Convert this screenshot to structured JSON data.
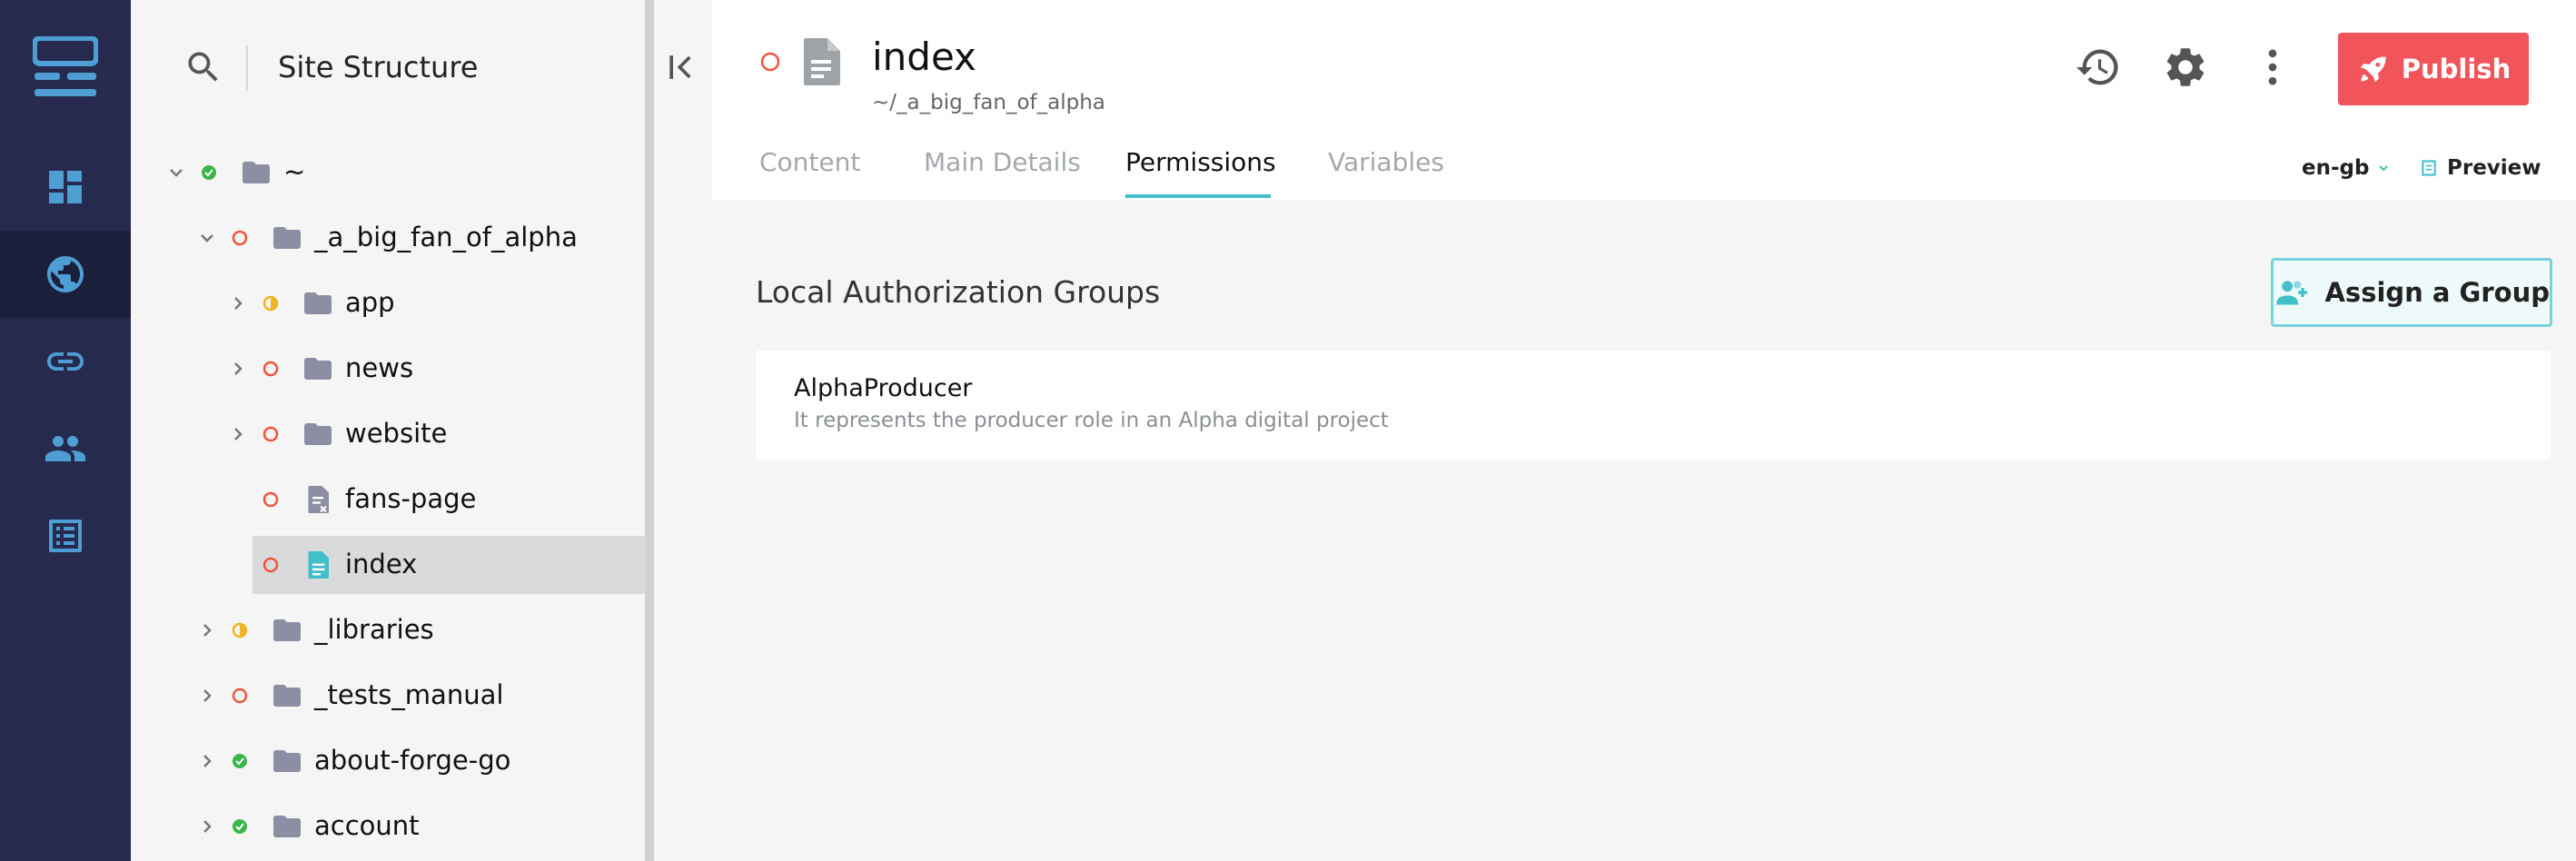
{
  "colors": {
    "rail_bg": "#252a4e",
    "rail_icon": "#4e9ed3",
    "accent_teal": "#42bfcb",
    "publish_red": "#f2545b",
    "status_green": "#3bb54a",
    "status_red": "#f0553c",
    "status_yellow": "#f2b322",
    "folder_gray": "#8c8fa3"
  },
  "rail": {
    "items": [
      {
        "name": "dashboard",
        "icon": "dashboard-icon",
        "active": false
      },
      {
        "name": "sites",
        "icon": "globe-icon",
        "active": true
      },
      {
        "name": "links",
        "icon": "link-icon",
        "active": false
      },
      {
        "name": "users",
        "icon": "users-icon",
        "active": false
      },
      {
        "name": "lists",
        "icon": "list-icon",
        "active": false
      }
    ]
  },
  "tree": {
    "title": "Site Structure",
    "rows": [
      {
        "label": "~",
        "expanded": true,
        "status": "green",
        "icon": "folder-icon"
      },
      {
        "label": "_a_big_fan_of_alpha",
        "expanded": true,
        "status": "red",
        "icon": "folder-icon"
      },
      {
        "label": "app",
        "expanded": false,
        "status": "yellow",
        "icon": "folder-icon"
      },
      {
        "label": "news",
        "expanded": false,
        "status": "red",
        "icon": "folder-icon"
      },
      {
        "label": "website",
        "expanded": false,
        "status": "red",
        "icon": "folder-icon"
      },
      {
        "label": "fans-page",
        "expanded": null,
        "status": "red",
        "icon": "link-page-icon"
      },
      {
        "label": "index",
        "expanded": null,
        "status": "red",
        "icon": "page-icon",
        "selected": true
      },
      {
        "label": "_libraries",
        "expanded": false,
        "status": "yellow",
        "icon": "folder-icon"
      },
      {
        "label": "_tests_manual",
        "expanded": false,
        "status": "red",
        "icon": "folder-icon"
      },
      {
        "label": "about-forge-go",
        "expanded": false,
        "status": "green",
        "icon": "folder-icon"
      },
      {
        "label": "account",
        "expanded": false,
        "status": "green",
        "icon": "folder-icon"
      }
    ]
  },
  "page": {
    "title": "index",
    "path": "~/_a_big_fan_of_alpha",
    "status": "red"
  },
  "toolbar": {
    "publish_label": "Publish",
    "history_icon": "history-icon",
    "settings_icon": "gear-icon",
    "more_icon": "more-vertical-icon"
  },
  "tabs": [
    {
      "label": "Content",
      "active": false
    },
    {
      "label": "Main Details",
      "active": false
    },
    {
      "label": "Permissions",
      "active": true
    },
    {
      "label": "Variables",
      "active": false
    }
  ],
  "language": {
    "selected": "en-gb"
  },
  "preview_label": "Preview",
  "permissions": {
    "section_title": "Local Authorization Groups",
    "assign_label": "Assign a Group",
    "groups": [
      {
        "name": "AlphaProducer",
        "description": "It represents the producer role in an Alpha digital project"
      }
    ]
  }
}
